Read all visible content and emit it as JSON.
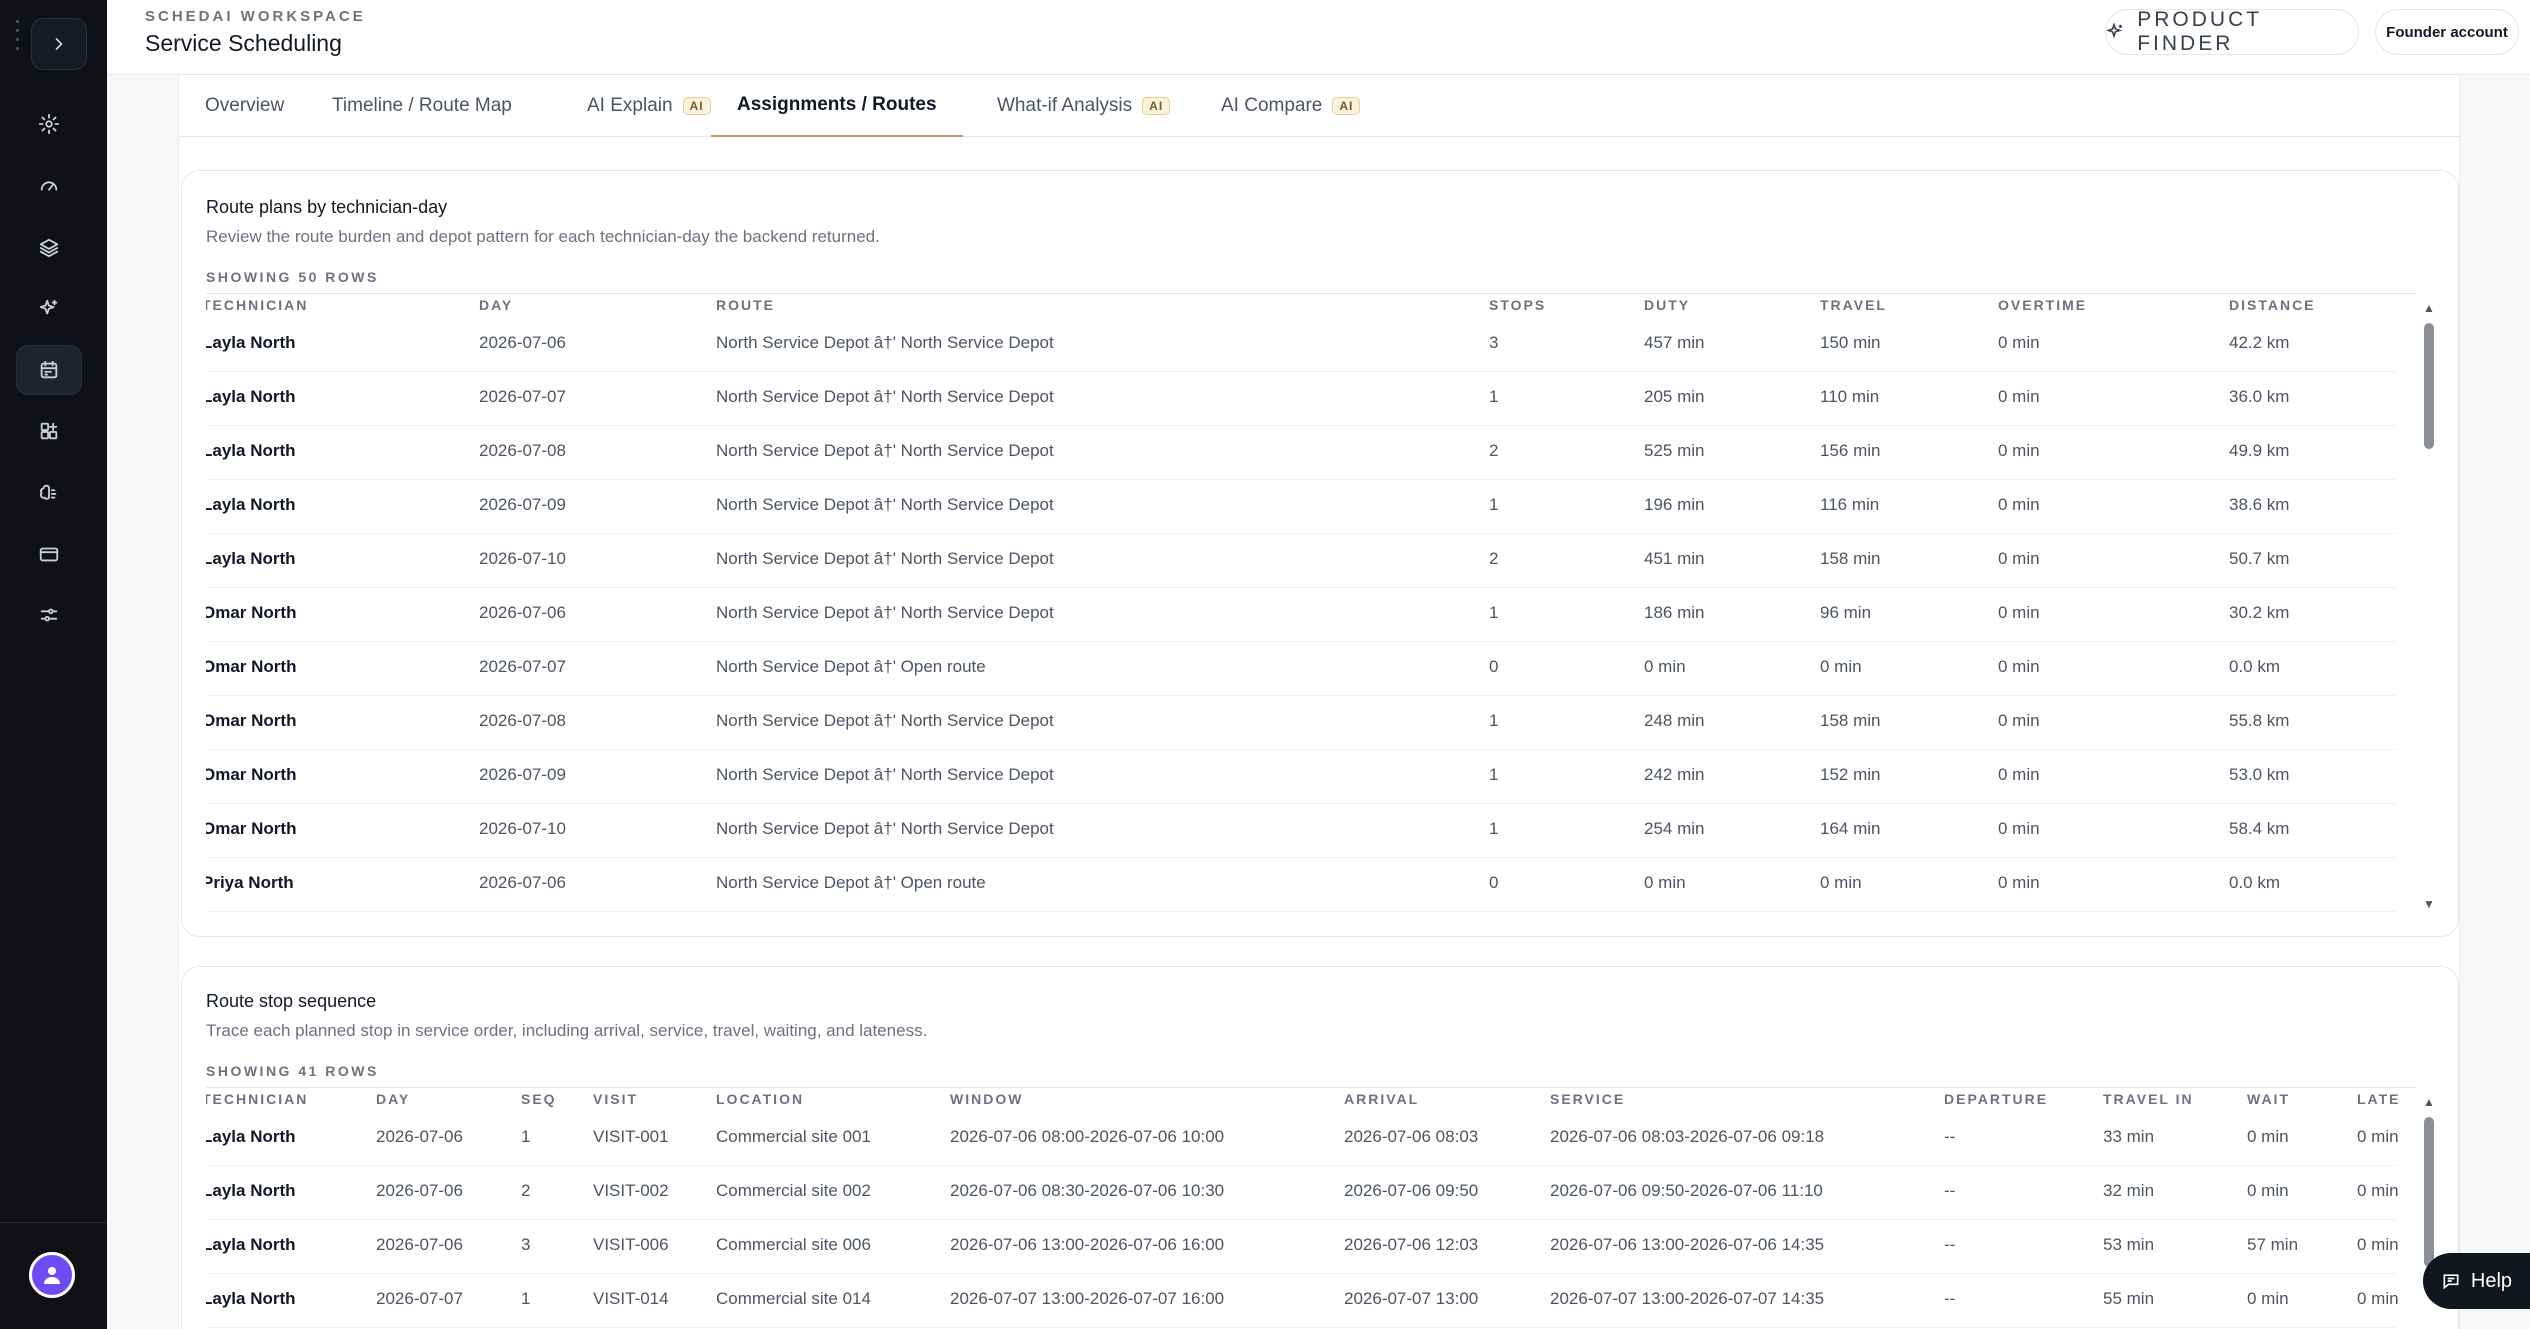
{
  "header": {
    "workspace": "SCHEDAI WORKSPACE",
    "title": "Service Scheduling",
    "product_finder": "PRODUCT FINDER",
    "account": "Founder account"
  },
  "sidebar": {
    "toggle_icon": "chevron-right-icon",
    "items": [
      {
        "icon": "settings-icon"
      },
      {
        "icon": "gauge-icon"
      },
      {
        "icon": "layers-icon"
      },
      {
        "icon": "sparkles-icon"
      },
      {
        "icon": "calendar-icon",
        "active": true
      },
      {
        "icon": "grid-plus-icon"
      },
      {
        "icon": "brain-icon"
      },
      {
        "icon": "card-icon"
      },
      {
        "icon": "sliders-icon"
      }
    ]
  },
  "tabs": [
    {
      "label": "Overview"
    },
    {
      "label": "Timeline / Route Map"
    },
    {
      "label": "AI Explain",
      "badge": "AI"
    },
    {
      "label": "Assignments / Routes",
      "active": true
    },
    {
      "label": "What-if Analysis",
      "badge": "AI"
    },
    {
      "label": "AI Compare",
      "badge": "AI"
    }
  ],
  "route_plans": {
    "title": "Route plans by technician-day",
    "subtitle": "Review the route burden and depot pattern for each technician-day the backend returned.",
    "row_count": "SHOWING 50 ROWS",
    "columns": [
      "TECHNICIAN",
      "DAY",
      "ROUTE",
      "STOPS",
      "DUTY",
      "TRAVEL",
      "OVERTIME",
      "DISTANCE"
    ],
    "rows": [
      [
        "Layla North",
        "2026-07-06",
        "North Service Depot â†' North Service Depot",
        "3",
        "457 min",
        "150 min",
        "0 min",
        "42.2 km"
      ],
      [
        "Layla North",
        "2026-07-07",
        "North Service Depot â†' North Service Depot",
        "1",
        "205 min",
        "110 min",
        "0 min",
        "36.0 km"
      ],
      [
        "Layla North",
        "2026-07-08",
        "North Service Depot â†' North Service Depot",
        "2",
        "525 min",
        "156 min",
        "0 min",
        "49.9 km"
      ],
      [
        "Layla North",
        "2026-07-09",
        "North Service Depot â†' North Service Depot",
        "1",
        "196 min",
        "116 min",
        "0 min",
        "38.6 km"
      ],
      [
        "Layla North",
        "2026-07-10",
        "North Service Depot â†' North Service Depot",
        "2",
        "451 min",
        "158 min",
        "0 min",
        "50.7 km"
      ],
      [
        "Omar North",
        "2026-07-06",
        "North Service Depot â†' North Service Depot",
        "1",
        "186 min",
        "96 min",
        "0 min",
        "30.2 km"
      ],
      [
        "Omar North",
        "2026-07-07",
        "North Service Depot â†' Open route",
        "0",
        "0 min",
        "0 min",
        "0 min",
        "0.0 km"
      ],
      [
        "Omar North",
        "2026-07-08",
        "North Service Depot â†' North Service Depot",
        "1",
        "248 min",
        "158 min",
        "0 min",
        "55.8 km"
      ],
      [
        "Omar North",
        "2026-07-09",
        "North Service Depot â†' North Service Depot",
        "1",
        "242 min",
        "152 min",
        "0 min",
        "53.0 km"
      ],
      [
        "Omar North",
        "2026-07-10",
        "North Service Depot â†' North Service Depot",
        "1",
        "254 min",
        "164 min",
        "0 min",
        "58.4 km"
      ],
      [
        "Priya North",
        "2026-07-06",
        "North Service Depot â†' Open route",
        "0",
        "0 min",
        "0 min",
        "0 min",
        "0.0 km"
      ]
    ]
  },
  "stop_sequence": {
    "title": "Route stop sequence",
    "subtitle": "Trace each planned stop in service order, including arrival, service, travel, waiting, and lateness.",
    "row_count": "SHOWING 41 ROWS",
    "columns": [
      "TECHNICIAN",
      "DAY",
      "SEQ",
      "VISIT",
      "LOCATION",
      "WINDOW",
      "ARRIVAL",
      "SERVICE",
      "DEPARTURE",
      "TRAVEL IN",
      "WAIT",
      "LATE"
    ],
    "rows": [
      [
        "Layla North",
        "2026-07-06",
        "1",
        "VISIT-001",
        "Commercial site 001",
        "2026-07-06 08:00-2026-07-06 10:00",
        "2026-07-06 08:03",
        "2026-07-06 08:03-2026-07-06 09:18",
        "--",
        "33 min",
        "0 min",
        "0 min"
      ],
      [
        "Layla North",
        "2026-07-06",
        "2",
        "VISIT-002",
        "Commercial site 002",
        "2026-07-06 08:30-2026-07-06 10:30",
        "2026-07-06 09:50",
        "2026-07-06 09:50-2026-07-06 11:10",
        "--",
        "32 min",
        "0 min",
        "0 min"
      ],
      [
        "Layla North",
        "2026-07-06",
        "3",
        "VISIT-006",
        "Commercial site 006",
        "2026-07-06 13:00-2026-07-06 16:00",
        "2026-07-06 12:03",
        "2026-07-06 13:00-2026-07-06 14:35",
        "--",
        "53 min",
        "57 min",
        "0 min"
      ],
      [
        "Layla North",
        "2026-07-07",
        "1",
        "VISIT-014",
        "Commercial site 014",
        "2026-07-07 13:00-2026-07-07 16:00",
        "2026-07-07 13:00",
        "2026-07-07 13:00-2026-07-07 14:35",
        "--",
        "55 min",
        "0 min",
        "0 min"
      ]
    ]
  },
  "help": {
    "label": "Help"
  }
}
